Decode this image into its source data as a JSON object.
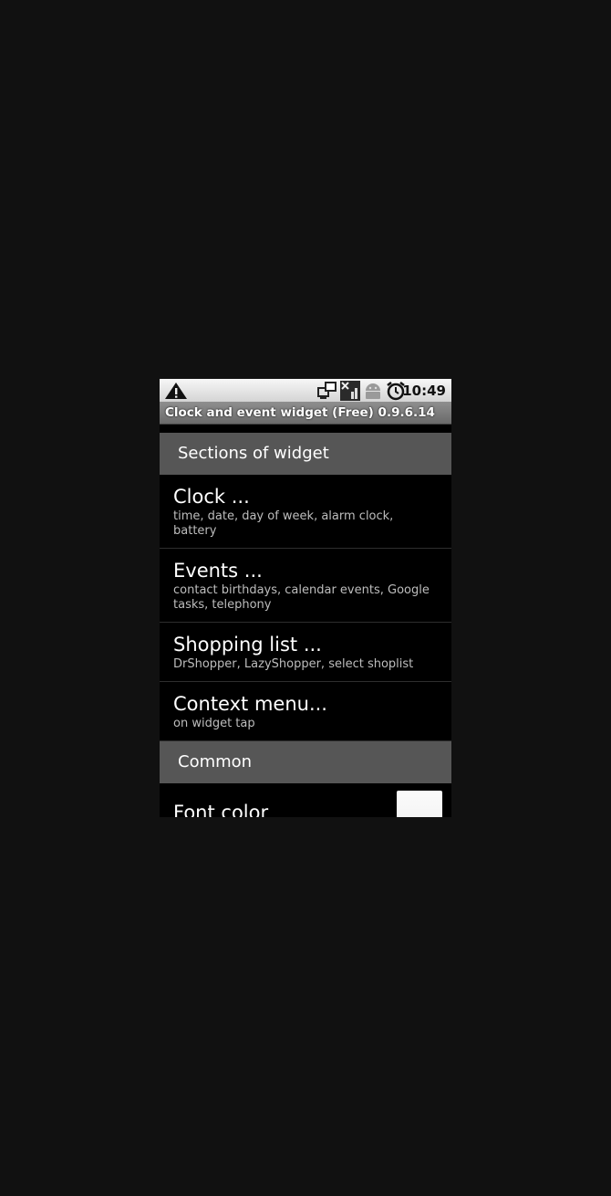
{
  "status_bar": {
    "time": "10:49",
    "icons": [
      "warning-icon",
      "sync-icon",
      "signal-icon",
      "android-icon",
      "alarm-icon"
    ]
  },
  "app": {
    "title": "Clock and event widget (Free) 0.9.6.14"
  },
  "sections": [
    {
      "header": "Sections of widget",
      "items": [
        {
          "title": "Clock ...",
          "summary": "time, date, day of week, alarm clock, battery"
        },
        {
          "title": "Events ...",
          "summary": "contact birthdays, calendar events, Google tasks, telephony"
        },
        {
          "title": "Shopping list ...",
          "summary": "DrShopper, LazyShopper, select shoplist"
        },
        {
          "title": "Context menu...",
          "summary": "on widget tap"
        }
      ]
    },
    {
      "header": "Common",
      "items": [
        {
          "title": "Font color",
          "swatch_color": "#ffffff"
        }
      ]
    }
  ],
  "colors": {
    "background": "#000000",
    "category_header": "#565656",
    "summary_text": "#bdbdbd"
  }
}
